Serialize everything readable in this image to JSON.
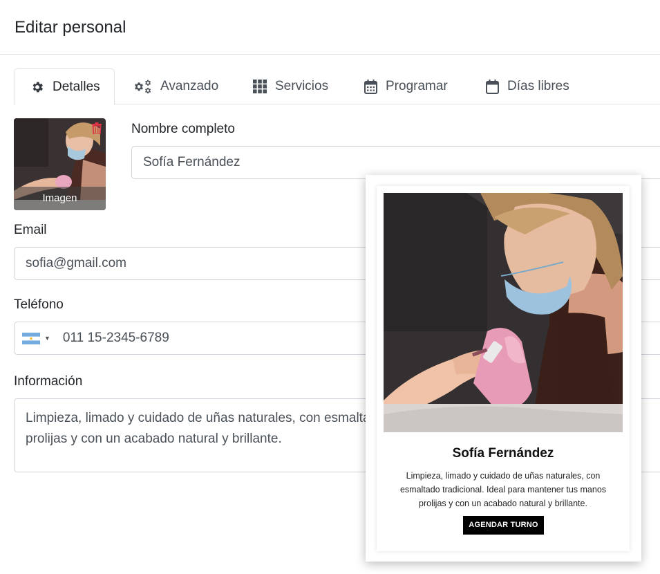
{
  "header": {
    "title": "Editar personal"
  },
  "tabs": [
    {
      "label": "Detalles",
      "icon": "gear-icon",
      "active": true
    },
    {
      "label": "Avanzado",
      "icon": "gears-icon",
      "active": false
    },
    {
      "label": "Servicios",
      "icon": "grid-icon",
      "active": false
    },
    {
      "label": "Programar",
      "icon": "calendar-icon",
      "active": false
    },
    {
      "label": "Días libres",
      "icon": "calendar-blank-icon",
      "active": false
    }
  ],
  "avatar": {
    "caption": "Imagen",
    "delete_icon": "trash-icon"
  },
  "form": {
    "full_name": {
      "label": "Nombre completo",
      "value": "Sofía Fernández"
    },
    "email": {
      "label": "Email",
      "value": "sofia@gmail.com"
    },
    "phone": {
      "label": "Teléfono",
      "value": "011 15-2345-6789",
      "country_icon": "argentina-flag-icon"
    },
    "info": {
      "label": "Información",
      "value": "Limpieza, limado y cuidado de uñas naturales, con esmaltado tradicional. Ideal para mantener tus manos prolijas y con un acabado natural y brillante."
    }
  },
  "preview": {
    "name": "Sofía Fernández",
    "description": "Limpieza, limado y cuidado de uñas naturales, con esmaltado tradicional. Ideal para mantener tus manos prolijas y con un acabado natural y brillante.",
    "button_label": "AGENDAR TURNO"
  },
  "colors": {
    "border": "#dee2e6",
    "danger": "#dc3545",
    "button": "#000000"
  }
}
